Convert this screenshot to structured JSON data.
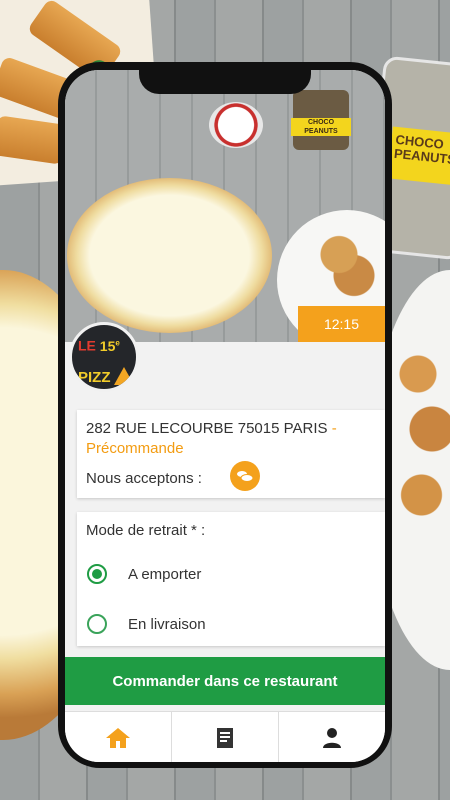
{
  "status": {
    "time": "12:15"
  },
  "restaurant": {
    "logo_text": "LE 15e PIZZ",
    "address": "282 RUE LECOURBE  75015 PARIS",
    "separator": "-",
    "order_type": "Précommande",
    "accept_label": "Nous acceptons :"
  },
  "pickup": {
    "title": "Mode de retrait * :",
    "options": [
      {
        "label": "A emporter",
        "selected": true
      },
      {
        "label": "En livraison",
        "selected": false
      }
    ]
  },
  "cta": {
    "label": "Commander dans ce restaurant"
  },
  "tabs": [
    {
      "icon": "home-icon",
      "active": true
    },
    {
      "icon": "receipt-icon",
      "active": false
    },
    {
      "icon": "user-icon",
      "active": false
    }
  ],
  "background": {
    "pack_label": "CHOCO PEANUTS"
  },
  "colors": {
    "accent": "#f4a11c",
    "primary": "#1f9c44"
  }
}
